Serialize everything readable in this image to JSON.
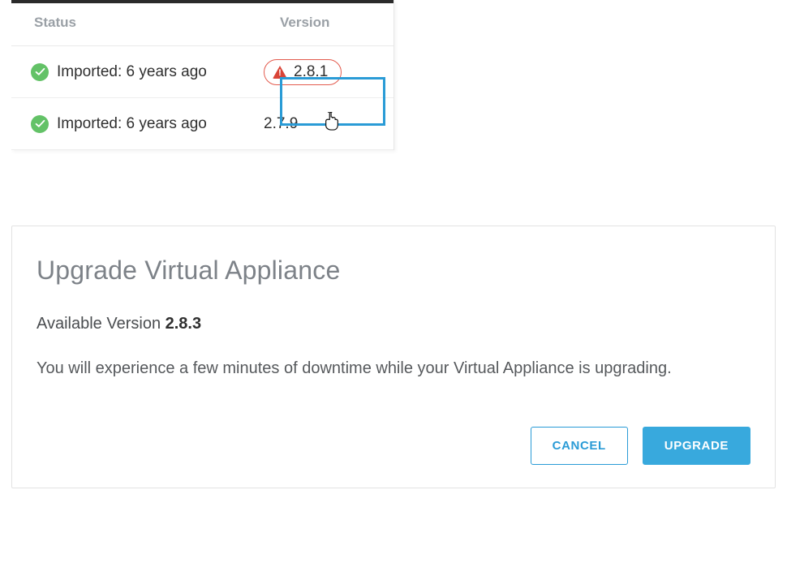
{
  "table": {
    "headers": {
      "status": "Status",
      "version": "Version"
    },
    "rows": [
      {
        "status": "Imported: 6 years ago",
        "version": "2.8.1",
        "warning": true
      },
      {
        "status": "Imported: 6 years ago",
        "version": "2.7.9",
        "warning": false
      }
    ]
  },
  "dialog": {
    "title": "Upgrade Virtual Appliance",
    "available_label": "Available Version ",
    "available_version": "2.8.3",
    "description": "You will experience a few minutes of downtime while your Virtual Appliance is upgrading.",
    "cancel_label": "CANCEL",
    "upgrade_label": "UPGRADE"
  }
}
